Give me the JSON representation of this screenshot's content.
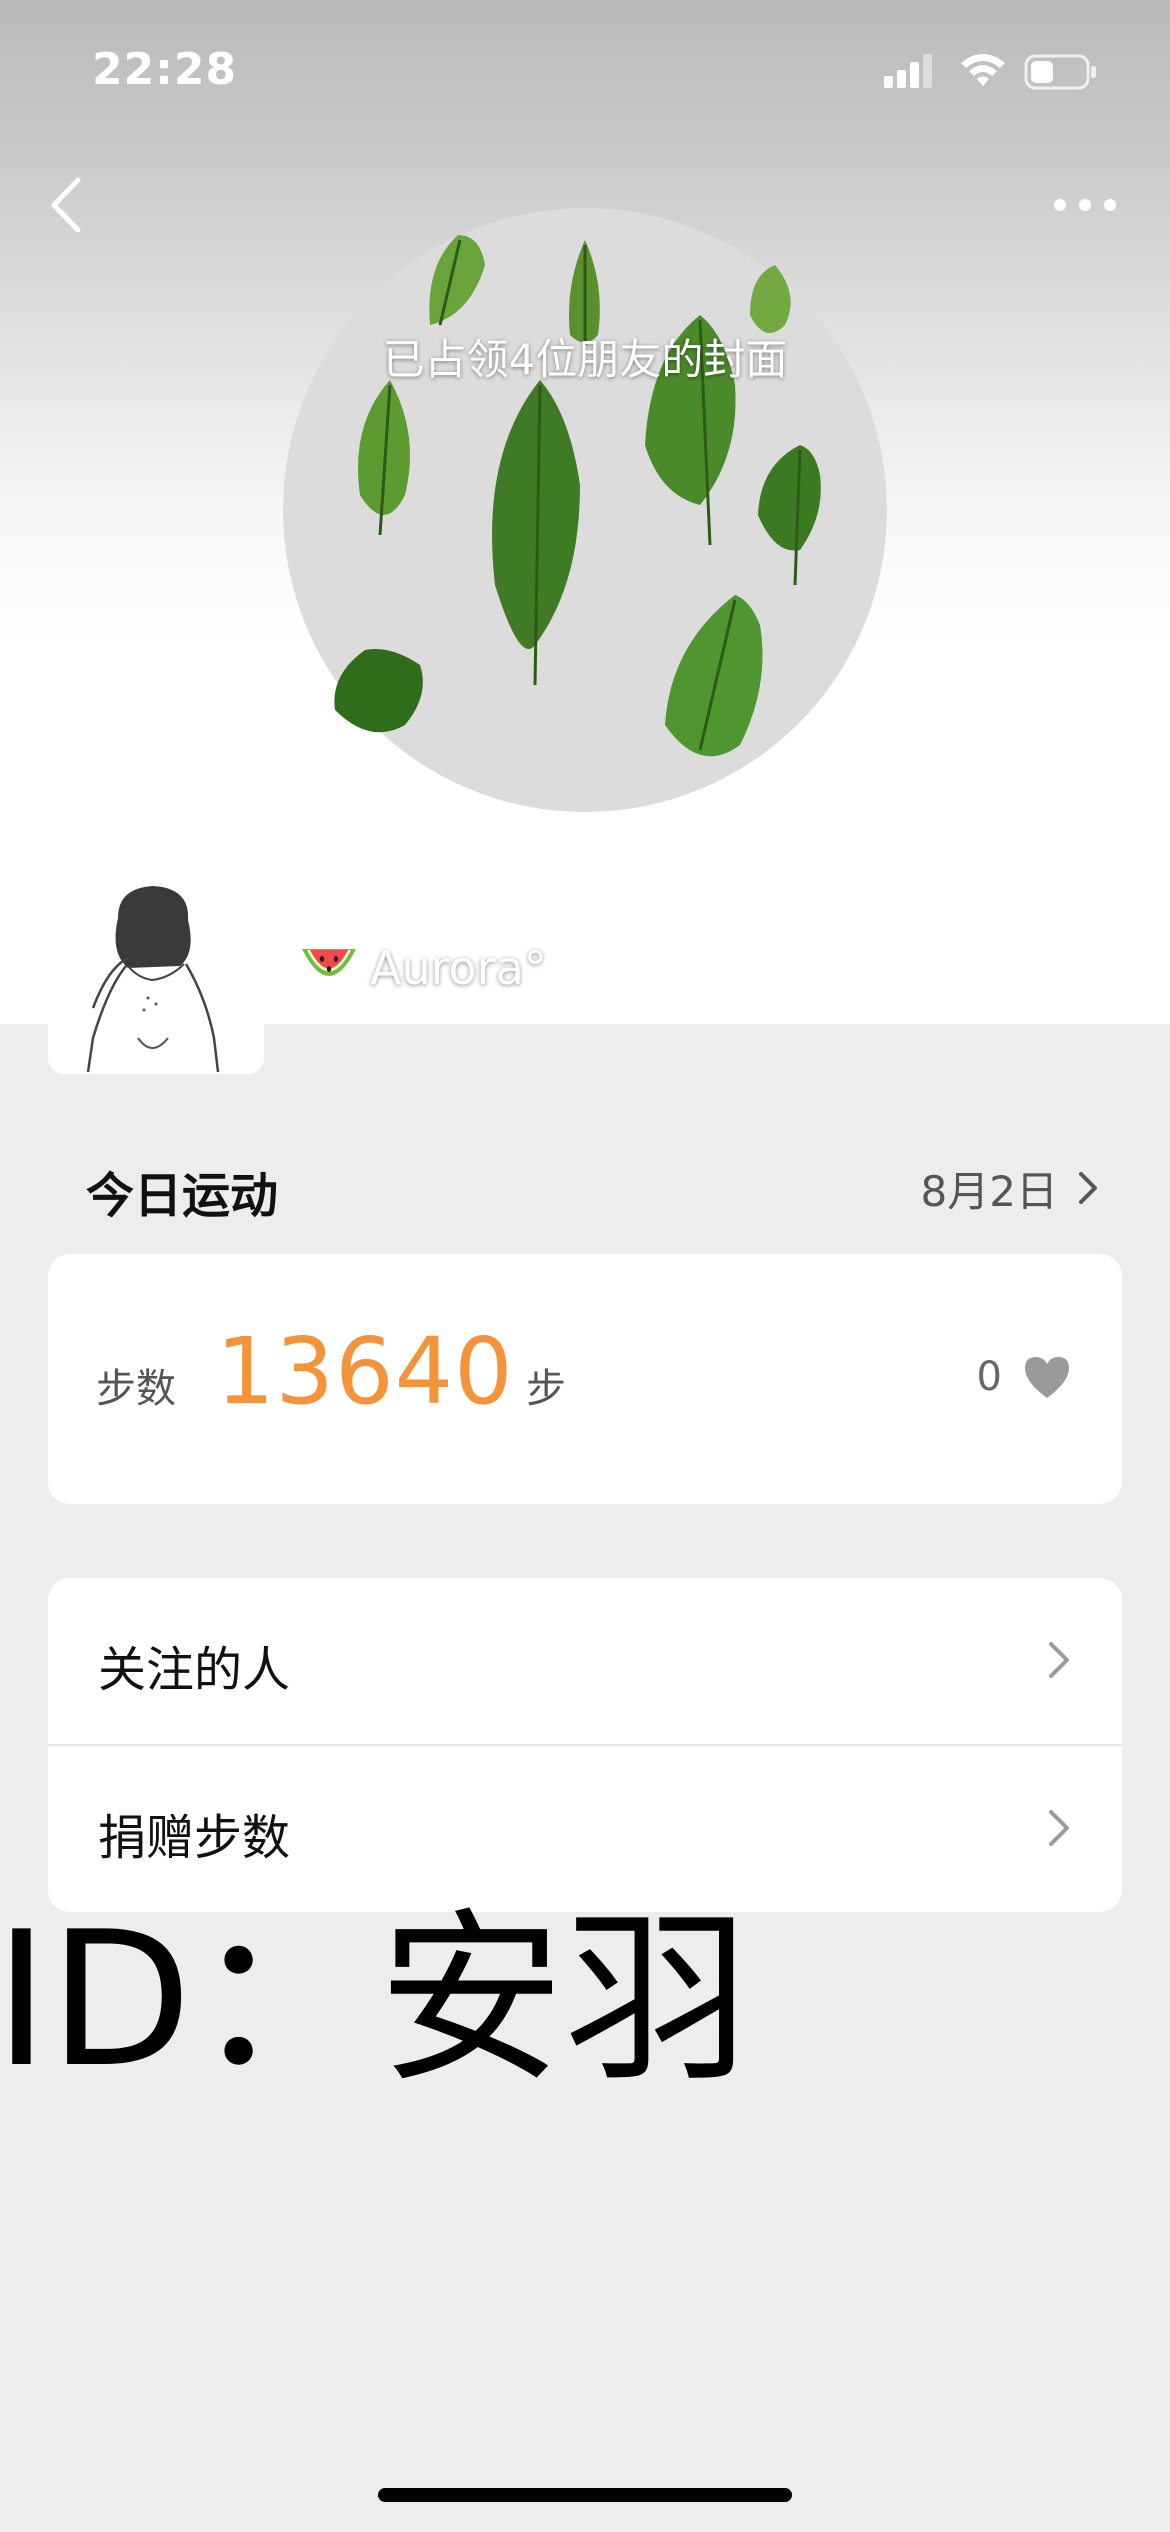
{
  "status_bar": {
    "time": "22:28",
    "icons": [
      "cellular-signal-icon",
      "wifi-icon",
      "battery-icon"
    ]
  },
  "header": {
    "back_icon": "chevron-left-icon",
    "more_icon": "ellipsis-icon"
  },
  "cover": {
    "caption": "已占领4位朋友的封面",
    "image": "watercolor-leaves-illustration"
  },
  "profile": {
    "avatar": "sketch-portrait",
    "nickname_emoji": "watermelon",
    "nickname": "Aurora°"
  },
  "today": {
    "title": "今日运动",
    "date": "8月2日",
    "steps_label": "步数",
    "steps_value": "13640",
    "steps_unit": "步",
    "likes_count": "0"
  },
  "menu": {
    "items": [
      {
        "label": "关注的人"
      },
      {
        "label": "捐赠步数"
      }
    ]
  },
  "watermark": "ID：安羽",
  "colors": {
    "steps_accent": "#f3933a",
    "page_background": "#ededed",
    "card_background": "#ffffff",
    "heart": "#9a9a9a"
  }
}
